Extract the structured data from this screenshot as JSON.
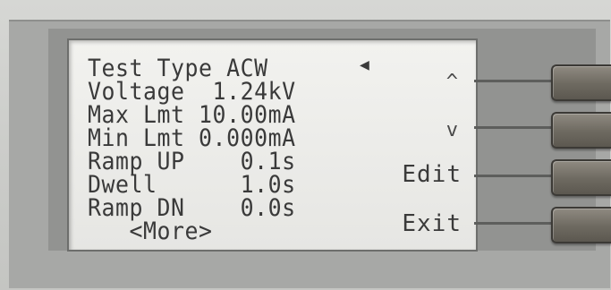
{
  "display": {
    "lines": [
      "Test Type ACW",
      "Voltage  1.24kV",
      "Max Lmt 10.00mA",
      "Min Lmt 0.000mA",
      "Ramp UP    0.1s",
      "Dwell      1.0s",
      "Ramp DN    0.0s",
      "   <More>"
    ],
    "cursor_icon": "left-triangle-icon"
  },
  "softkeys": {
    "up_label": "^",
    "down_label": "v",
    "edit_label": "Edit",
    "exit_label": "Exit"
  },
  "colors": {
    "lcd_background": "#ecece9",
    "lcd_text": "#3a3a3a",
    "button": "#6d6960",
    "panel": "#cfd0cd"
  }
}
